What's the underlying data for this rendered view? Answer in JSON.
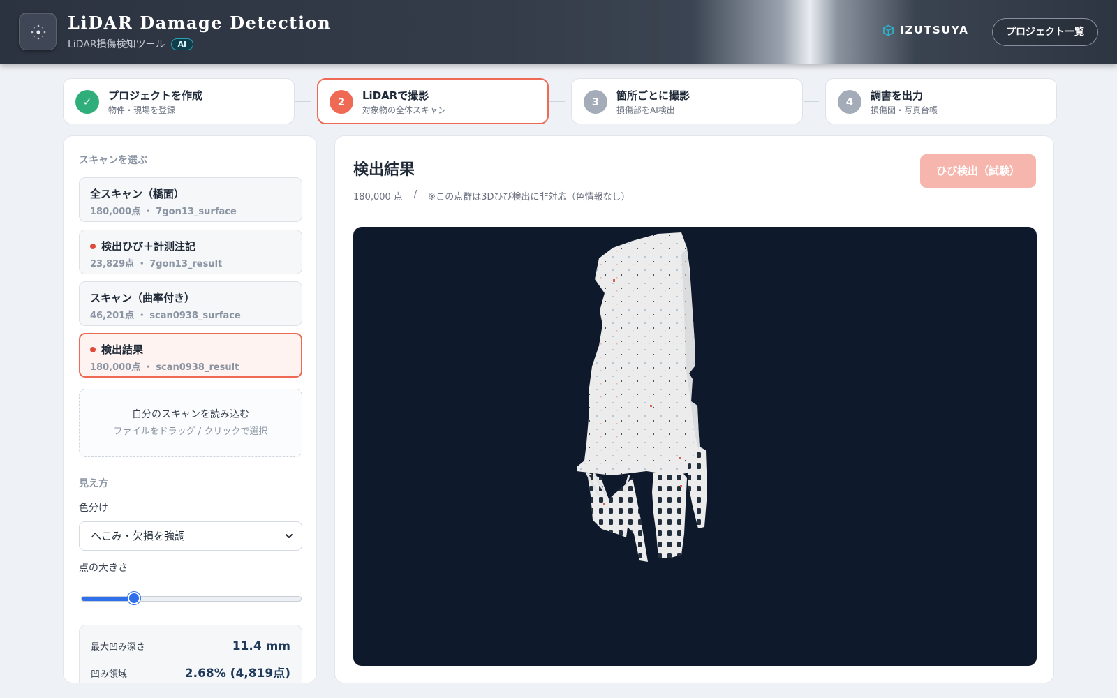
{
  "header": {
    "title": "LiDAR Damage Detection",
    "subtitle": "LiDAR損傷検知ツール",
    "ai_badge": "AI",
    "brand": "IZUTSUYA",
    "project_list_label": "プロジェクト一覧"
  },
  "steps": [
    {
      "number": "✓",
      "title": "プロジェクトを作成",
      "subtitle": "物件・現場を登録",
      "state": "done"
    },
    {
      "number": "2",
      "title": "LiDARで撮影",
      "subtitle": "対象物の全体スキャン",
      "state": "active"
    },
    {
      "number": "3",
      "title": "箇所ごとに撮影",
      "subtitle": "損傷部をAI検出",
      "state": "pending"
    },
    {
      "number": "4",
      "title": "調書を出力",
      "subtitle": "損傷図・写真台帳",
      "state": "pending"
    }
  ],
  "sidebar": {
    "scan_section_label": "スキャンを選ぶ",
    "scans": [
      {
        "title": "全スキャン（橋面）",
        "points": "180,000点",
        "file": "7gon13_surface",
        "dot": false,
        "selected": false
      },
      {
        "title": "検出ひび＋計測注記",
        "points": "23,829点",
        "file": "7gon13_result",
        "dot": true,
        "selected": false
      },
      {
        "title": "スキャン（曲率付き）",
        "points": "46,201点",
        "file": "scan0938_surface",
        "dot": false,
        "selected": false
      },
      {
        "title": "検出結果",
        "points": "180,000点",
        "file": "scan0938_result",
        "dot": true,
        "selected": true
      }
    ],
    "meta_separator": "・",
    "upload": {
      "title": "自分のスキャンを読み込む",
      "hint": "ファイルをドラッグ / クリックで選択"
    },
    "view_section_label": "見え方",
    "color_label": "色分け",
    "color_selected": "へこみ・欠損を強調",
    "point_size_label": "点の大きさ",
    "point_size_fraction": 0.24,
    "stats": [
      {
        "label": "最大凹み深さ",
        "value": "11.4 mm"
      },
      {
        "label": "凹み領域",
        "value": "2.68% (4,819点)"
      }
    ]
  },
  "main": {
    "title": "検出結果",
    "point_count": "180,000 点",
    "separator": "/",
    "note": "※この点群は3Dひび検出に非対応（色情報なし）",
    "crack_button_label": "ひび検出（試験）"
  },
  "colors": {
    "accent": "#ee6a54",
    "done": "#2fae7a",
    "pending": "#a3acb8",
    "viewer_bg": "#0e1a2b",
    "slider": "#2f6fea"
  }
}
